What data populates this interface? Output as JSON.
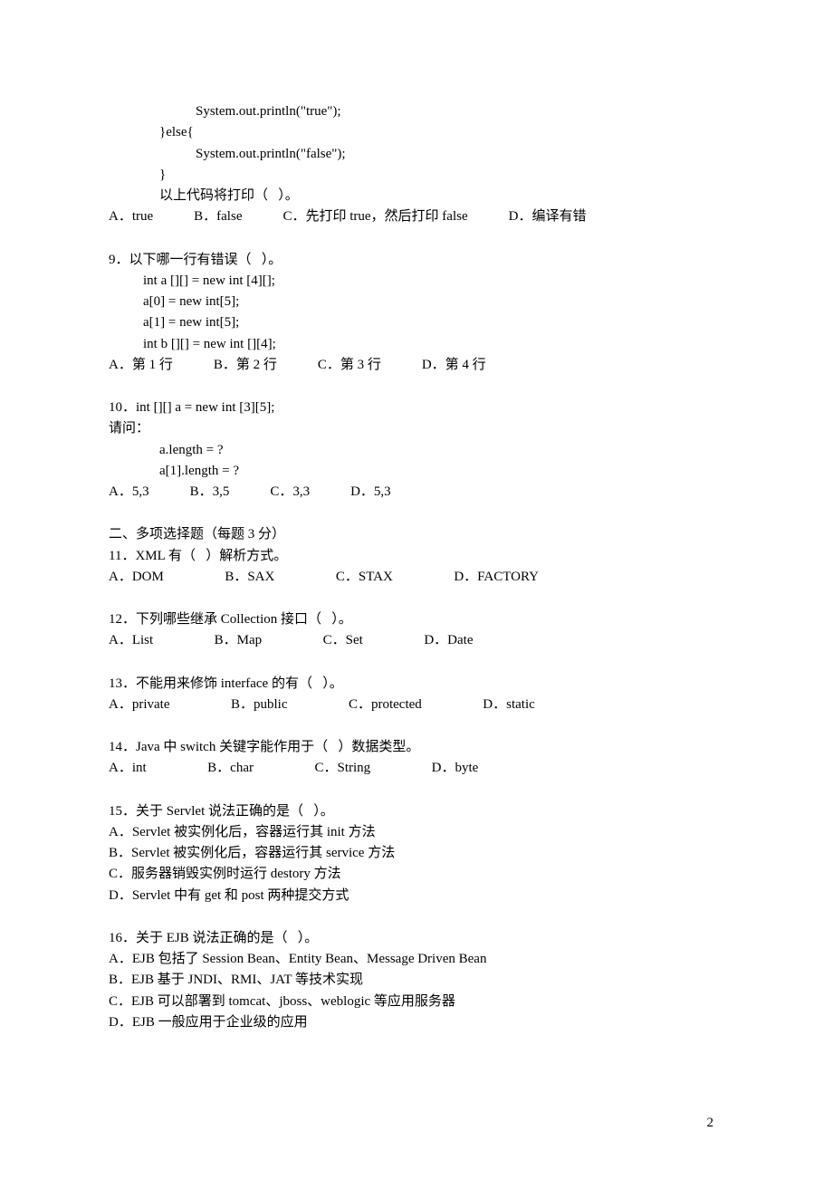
{
  "q8": {
    "code": [
      "System.out.println(\"true\");",
      "}else{",
      "System.out.println(\"false\");",
      "}"
    ],
    "tail": "以上代码将打印（   ）。",
    "opts": "A．true            B．false            C．先打印 true，然后打印 false            D．编译有错"
  },
  "q9": {
    "stem": "9．以下哪一行有错误（   ）。",
    "code": [
      "int a [][] = new int [4][];",
      "a[0] = new int[5];",
      "a[1] = new int[5];",
      "int b [][] = new int [][4];"
    ],
    "opts": "A．第 1 行            B．第 2 行            C．第 3 行            D．第 4 行"
  },
  "q10": {
    "stem": "10．int [][] a = new int [3][5];",
    "ask": "请问：",
    "code": [
      "a.length = ?",
      "a[1].length = ?"
    ],
    "opts": "A．5,3            B．3,5            C．3,3            D．5,3"
  },
  "section2": "二、多项选择题（每题 3 分）",
  "q11": {
    "stem": "11．XML 有（   ）解析方式。",
    "opts": "A．DOM                  B．SAX                  C．STAX                  D．FACTORY"
  },
  "q12": {
    "stem": "12．下列哪些继承 Collection 接口（   ）。",
    "opts": "A．List                  B．Map                  C．Set                  D．Date"
  },
  "q13": {
    "stem": "13．不能用来修饰 interface 的有（   ）。",
    "opts": "A．private                  B．public                  C．protected                  D．static"
  },
  "q14": {
    "stem": "14．Java 中 switch 关键字能作用于（   ）数据类型。",
    "opts": "A．int                  B．char                  C．String                  D．byte"
  },
  "q15": {
    "stem": "15．关于 Servlet 说法正确的是（   ）。",
    "a": "A．Servlet 被实例化后，容器运行其 init 方法",
    "b": "B．Servlet 被实例化后，容器运行其 service 方法",
    "c": "C．服务器销毁实例时运行 destory 方法",
    "d": "D．Servlet 中有 get 和 post 两种提交方式"
  },
  "q16": {
    "stem": "16．关于 EJB 说法正确的是（   ）。",
    "a": "A．EJB 包括了 Session Bean、Entity Bean、Message Driven Bean",
    "b": "B．EJB 基于 JNDI、RMI、JAT 等技术实现",
    "c": "C．EJB 可以部署到 tomcat、jboss、weblogic 等应用服务器",
    "d": "D．EJB 一般应用于企业级的应用"
  },
  "pagenum": "2"
}
